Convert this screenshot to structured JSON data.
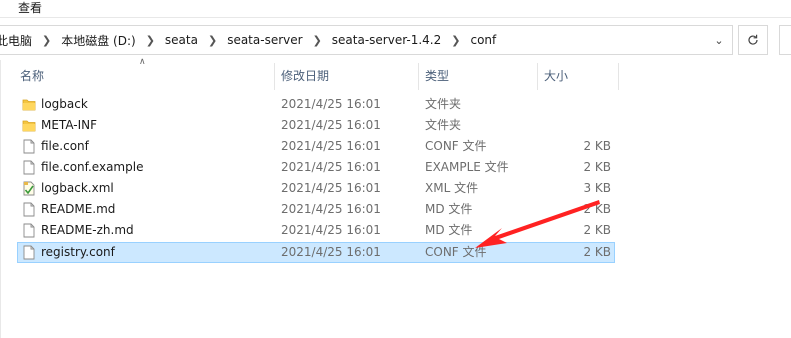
{
  "ribbon": {
    "view_tab": "查看"
  },
  "breadcrumb": [
    "此电脑",
    "本地磁盘 (D:)",
    "seata",
    "seata-server",
    "seata-server-1.4.2",
    "conf"
  ],
  "icons": {
    "separator": "chevron-right-icon",
    "address_dropdown": "chevron-down-icon",
    "refresh": "refresh-icon"
  },
  "columns": {
    "name": "名称",
    "modified": "修改日期",
    "type": "类型",
    "size": "大小"
  },
  "files": [
    {
      "name": "logback",
      "modified": "2021/4/25 16:01",
      "type": "文件夹",
      "size": "",
      "icon": "folder-icon"
    },
    {
      "name": "META-INF",
      "modified": "2021/4/25 16:01",
      "type": "文件夹",
      "size": "",
      "icon": "folder-icon"
    },
    {
      "name": "file.conf",
      "modified": "2021/4/25 16:01",
      "type": "CONF 文件",
      "size": "2 KB",
      "icon": "document-icon"
    },
    {
      "name": "file.conf.example",
      "modified": "2021/4/25 16:01",
      "type": "EXAMPLE 文件",
      "size": "2 KB",
      "icon": "document-icon"
    },
    {
      "name": "logback.xml",
      "modified": "2021/4/25 16:01",
      "type": "XML 文件",
      "size": "3 KB",
      "icon": "xml-file-icon"
    },
    {
      "name": "README.md",
      "modified": "2021/4/25 16:01",
      "type": "MD 文件",
      "size": "2 KB",
      "icon": "document-icon"
    },
    {
      "name": "README-zh.md",
      "modified": "2021/4/25 16:01",
      "type": "MD 文件",
      "size": "2 KB",
      "icon": "document-icon"
    },
    {
      "name": "registry.conf",
      "modified": "2021/4/25 16:01",
      "type": "CONF 文件",
      "size": "2 KB",
      "icon": "document-icon",
      "selected": true
    }
  ],
  "colors": {
    "selection_bg": "#cce8ff",
    "selection_border": "#99d1ff",
    "annotation_arrow": "#ff2222",
    "folder": "#f4c542"
  }
}
